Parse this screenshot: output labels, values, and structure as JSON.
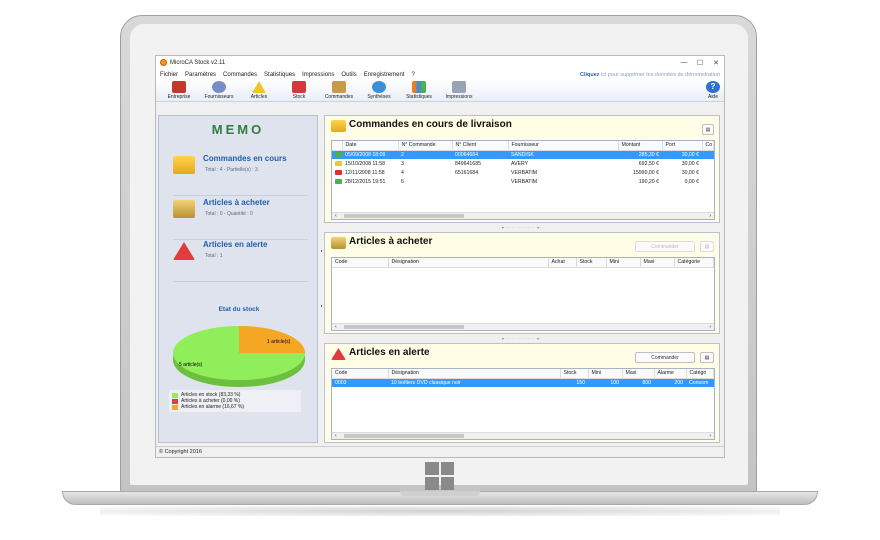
{
  "window": {
    "title": "MicroCA Stock v2.11",
    "min": "—",
    "max": "☐",
    "close": "✕"
  },
  "menu": {
    "items": [
      "Fichier",
      "Paramètres",
      "Commandes",
      "Statistiques",
      "Impressions",
      "Outils",
      "Enregistrement",
      "?"
    ],
    "notice_link": "Cliquez",
    "notice_rest": " ici pour supprimer les données de démonstration"
  },
  "toolbar": {
    "items": [
      {
        "label": "Entreprise",
        "icon": "factory-icon",
        "color": "#c0392b"
      },
      {
        "label": "Fournisseurs",
        "icon": "people-icon",
        "color": "#7a8cc8"
      },
      {
        "label": "Articles",
        "icon": "tents-icon",
        "color": "#f2c530"
      },
      {
        "label": "Stock",
        "icon": "boxes-icon",
        "color": "#d13a3a"
      },
      {
        "label": "Commandes",
        "icon": "cart-icon",
        "color": "#c89a4a"
      },
      {
        "label": "Synthèses",
        "icon": "gears-icon",
        "color": "#3a8fd8"
      },
      {
        "label": "Statistiques",
        "icon": "chart-icon",
        "color": "#e87d22"
      },
      {
        "label": "Impressions",
        "icon": "printer-icon",
        "color": "#9aa3b5"
      }
    ],
    "aide": "Aide"
  },
  "memo": {
    "title": "MEMO",
    "commandes": {
      "label": "Commandes en cours",
      "sub": "Total : 4 - Partielle(s) : 3"
    },
    "acheter": {
      "label": "Articles à acheter",
      "sub": "Total : 0 - Quantité : 0"
    },
    "alerte": {
      "label": "Articles en alerte",
      "sub": "Total : 1"
    },
    "stock_title": "Etat du stock",
    "pie": {
      "slices": [
        {
          "label": "5 article(s)",
          "value": 5,
          "color": "#90ee5a"
        },
        {
          "label": "1 article(s)",
          "value": 1,
          "color": "#f5a623"
        }
      ]
    },
    "legend": [
      {
        "label": "Articles en stock (83,33 %)",
        "color": "#90ee5a"
      },
      {
        "label": "Articles à acheter (0,00 %)",
        "color": "#e03c3c"
      },
      {
        "label": "Articles en alarme (16,67 %)",
        "color": "#f5a623"
      }
    ]
  },
  "commandes_panel": {
    "title": "Commandes en cours de livraison",
    "columns": [
      "Date",
      "N° Commande",
      "N° Client",
      "Fournisseur",
      "Montant",
      "Port",
      "Co"
    ],
    "rows": [
      {
        "icon": "#4caf50",
        "date": "05/09/2008 18:09",
        "num": "2",
        "client": "00064684",
        "fournisseur": "SANDISK",
        "montant": "285,30 €",
        "port": "30,00 €",
        "selected": true
      },
      {
        "icon": "#e8c840",
        "date": "15/10/2008 11:58",
        "num": "3",
        "client": "849641685",
        "fournisseur": "AVERY",
        "montant": "692,50 €",
        "port": "30,00 €",
        "selected": false
      },
      {
        "icon": "#d9342b",
        "date": "12/11/2008 11:58",
        "num": "4",
        "client": "65161684",
        "fournisseur": "VERBATIM",
        "montant": "15990,00 €",
        "port": "30,00 €",
        "selected": false
      },
      {
        "icon": "#4caf50",
        "date": "28/12/2015 19:51",
        "num": "6",
        "client": "",
        "fournisseur": "VERBATIM",
        "montant": "190,20 €",
        "port": "0,00 €",
        "selected": false
      }
    ]
  },
  "acheter_panel": {
    "title": "Articles à acheter",
    "button": "Commander",
    "columns": [
      "Code",
      "Désignation",
      "Achat",
      "Stock",
      "Mini",
      "Maxi",
      "Catégorie"
    ]
  },
  "alerte_panel": {
    "title": "Articles en alerte",
    "button": "Commander",
    "columns": [
      "Code",
      "Désignation",
      "Stock",
      "Mini",
      "Maxi",
      "Alarme",
      "Catégo"
    ],
    "rows": [
      {
        "code": "0003",
        "designation": "10 boîtiers DVD classique noir",
        "stock": "150",
        "mini": "100",
        "maxi": "800",
        "alarme": "200",
        "categorie": "Consom",
        "selected": true
      }
    ]
  },
  "status": {
    "copyright": "© Copyright 2016"
  }
}
